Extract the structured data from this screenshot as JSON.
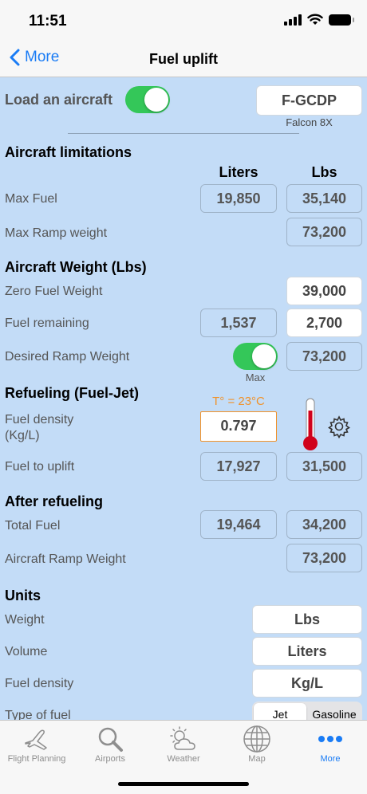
{
  "status": {
    "time": "11:51"
  },
  "nav": {
    "back_label": "More",
    "title": "Fuel uplift"
  },
  "load": {
    "label": "Load an aircraft",
    "toggle_on": true,
    "registration": "F-GCDP",
    "model": "Falcon 8X"
  },
  "limitations": {
    "title": "Aircraft limitations",
    "col_liters": "Liters",
    "col_lbs": "Lbs",
    "max_fuel": {
      "label": "Max Fuel",
      "liters": "19,850",
      "lbs": "35,140"
    },
    "max_ramp": {
      "label": "Max Ramp weight",
      "lbs": "73,200"
    }
  },
  "weight": {
    "title": "Aircraft Weight (Lbs)",
    "zero_fuel": {
      "label": "Zero Fuel Weight",
      "lbs": "39,000"
    },
    "fuel_remaining": {
      "label": "Fuel remaining",
      "liters": "1,537",
      "lbs": "2,700"
    },
    "desired_ramp": {
      "label": "Desired Ramp Weight",
      "toggle_on": true,
      "toggle_caption": "Max",
      "lbs": "73,200"
    }
  },
  "refueling": {
    "title": "Refueling (Fuel-Jet)",
    "temperature": "T° = 23°C",
    "density": {
      "label_line1": "Fuel density",
      "label_line2": "(Kg/L)",
      "value": "0.797"
    },
    "uplift": {
      "label": "Fuel to uplift",
      "liters": "17,927",
      "lbs": "31,500"
    }
  },
  "after": {
    "title": "After refueling",
    "total_fuel": {
      "label": "Total Fuel",
      "liters": "19,464",
      "lbs": "34,200"
    },
    "ramp_weight": {
      "label": "Aircraft Ramp Weight",
      "lbs": "73,200"
    }
  },
  "units": {
    "title": "Units",
    "weight": {
      "label": "Weight",
      "value": "Lbs"
    },
    "volume": {
      "label": "Volume",
      "value": "Liters"
    },
    "density": {
      "label": "Fuel density",
      "value": "Kg/L"
    },
    "fuel_type": {
      "label": "Type of fuel",
      "options": [
        "Jet",
        "Gasoline"
      ],
      "selected": "Jet"
    }
  },
  "tabs": [
    {
      "label": "Flight Planning",
      "icon": "airplane-icon"
    },
    {
      "label": "Airports",
      "icon": "magnifier-icon"
    },
    {
      "label": "Weather",
      "icon": "sun-cloud-icon"
    },
    {
      "label": "Map",
      "icon": "globe-icon"
    },
    {
      "label": "More",
      "icon": "more-dots-icon",
      "active": true
    }
  ],
  "colors": {
    "accent": "#1a7cf5",
    "background": "#c3dcf7",
    "toggle": "#34c759",
    "warning": "#f0922a",
    "thermometer": "#d0021b"
  }
}
